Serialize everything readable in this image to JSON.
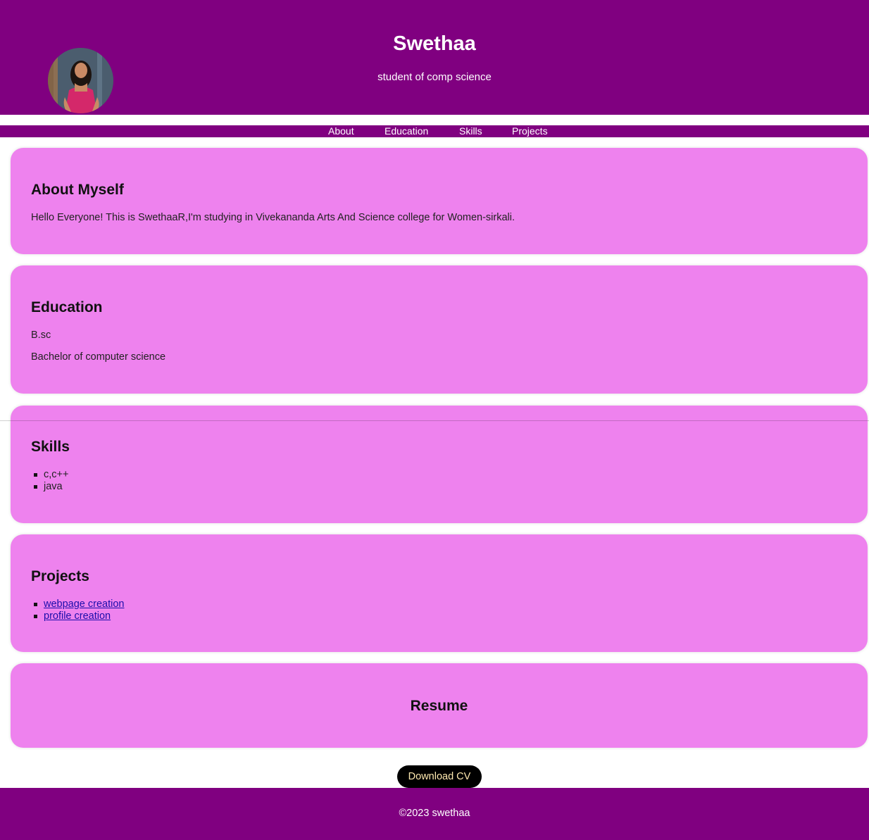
{
  "header": {
    "name": "Swethaa",
    "subtitle": "student of comp science"
  },
  "nav": {
    "items": [
      "About",
      "Education",
      "Skills",
      "Projects"
    ]
  },
  "about": {
    "heading": "About Myself",
    "text": "Hello Everyone! This is SwethaaR,I'm studying in Vivekananda Arts And Science college for Women-sirkali."
  },
  "education": {
    "heading": "Education",
    "degree": "B.sc",
    "detail": "Bachelor of computer science"
  },
  "skills": {
    "heading": "Skills",
    "items": [
      "c,c++",
      "java"
    ]
  },
  "projects": {
    "heading": "Projects",
    "items": [
      "webpage creation",
      "profile creation"
    ]
  },
  "resume": {
    "heading": "Resume",
    "button_label": "Download CV"
  },
  "footer": {
    "text": "©2023 swethaa"
  },
  "colors": {
    "header_bg": "#800080",
    "card_bg": "#ee82ee",
    "button_bg": "#000000",
    "link": "#1a0dab"
  }
}
